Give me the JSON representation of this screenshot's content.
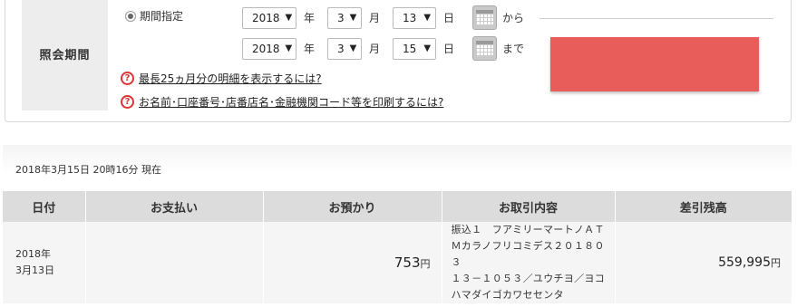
{
  "filter": {
    "section_label": "照会期間",
    "radio_label": "期間指定",
    "from": {
      "year": "2018",
      "month": "3",
      "day": "13",
      "suffix": "から"
    },
    "to": {
      "year": "2018",
      "month": "3",
      "day": "15",
      "suffix": "まで"
    },
    "units": {
      "year": "年",
      "month": "月",
      "day": "日"
    },
    "help_links": [
      "最長25ヵ月分の明細を表示するには?",
      "お名前･口座番号･店番店名･金融機関コード等を印刷するには?"
    ],
    "action_button_color": "#e85c5a"
  },
  "timestamp": "2018年3月15日  20時16分 現在",
  "table": {
    "headers": [
      "日付",
      "お支払い",
      "お預かり",
      "お取引内容",
      "差引残高"
    ],
    "rows": [
      {
        "date_line1": "2018年",
        "date_line2": "3月13日",
        "payment": "",
        "deposit": "753",
        "deposit_unit": "円",
        "description": [
          "振込１　フアミリーマートノＡＴ",
          "Ｍカラノフリコミデス２０１８０３",
          "１３－１０５３／ユウチヨ／ヨコ",
          "ハマダイゴカワセセンタ"
        ],
        "balance": "559,995",
        "balance_unit": "円"
      }
    ]
  }
}
